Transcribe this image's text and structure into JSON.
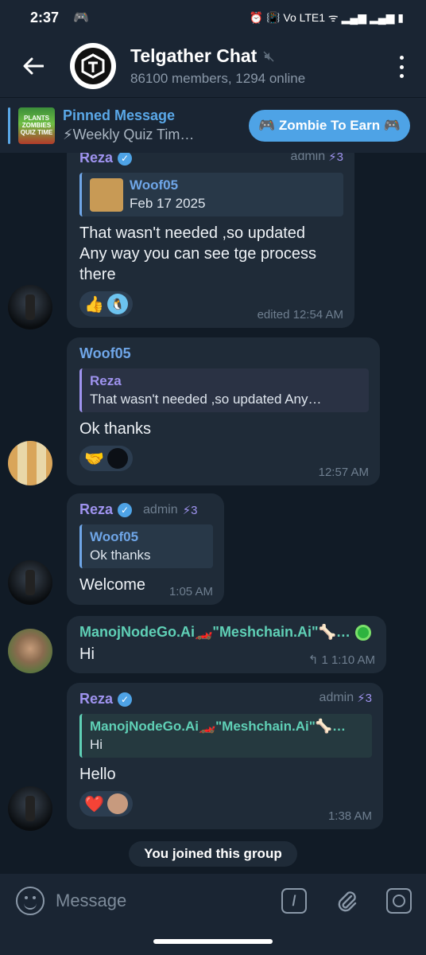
{
  "status_bar": {
    "time": "2:37",
    "indicators": "⏰ 📳 Vo LTE1 ᯤ ▂▄▆ ▂▄▆ ▮"
  },
  "header": {
    "back_icon": "arrow-left-icon",
    "title": "Telgather Chat",
    "muted_icon": "muted-speaker-icon",
    "subtitle": "86100 members, 1294 online"
  },
  "pinned": {
    "label": "Pinned Message",
    "thumb_lines": [
      "PLANTS",
      "ZOMBIES",
      "QUIZ TIME"
    ],
    "preview": "⚡Weekly Quiz Tim…",
    "button_label": "🎮 Zombie To Earn 🎮"
  },
  "messages": [
    {
      "sender": "Reza",
      "role": "admin",
      "boost": "⚡3",
      "reply_name": "Woof05",
      "reply_text": "Feb 17 2025",
      "text_lines": [
        "That wasn't needed ,so updated",
        "Any way you can see tge process",
        "there"
      ],
      "reactions": [
        "👍",
        "🐧"
      ],
      "meta": "edited 12:54 AM"
    },
    {
      "sender": "Woof05",
      "reply_name": "Reza",
      "reply_text": "That wasn't needed ,so updated  Any…",
      "text": "Ok thanks",
      "reactions": [
        "🤝"
      ],
      "meta": "12:57 AM"
    },
    {
      "sender": "Reza",
      "role": "admin",
      "boost": "⚡3",
      "reply_name": "Woof05",
      "reply_text": "Ok thanks",
      "text": "Welcome",
      "meta": "1:05 AM"
    },
    {
      "sender": "ManojNodeGo.Ai🏎️\"Meshchain.Ai\"🦴…",
      "text": "Hi",
      "meta": "↰ 1  1:10 AM"
    },
    {
      "sender": "Reza",
      "role": "admin",
      "boost": "⚡3",
      "reply_name": "ManojNodeGo.Ai🏎️\"Meshchain.Ai\"🦴…",
      "reply_text": "Hi",
      "text": "Hello",
      "reactions": [
        "❤️"
      ],
      "meta": "1:38 AM"
    }
  ],
  "system_message": "You joined this group",
  "input": {
    "placeholder": "Message",
    "command_label": "/"
  }
}
